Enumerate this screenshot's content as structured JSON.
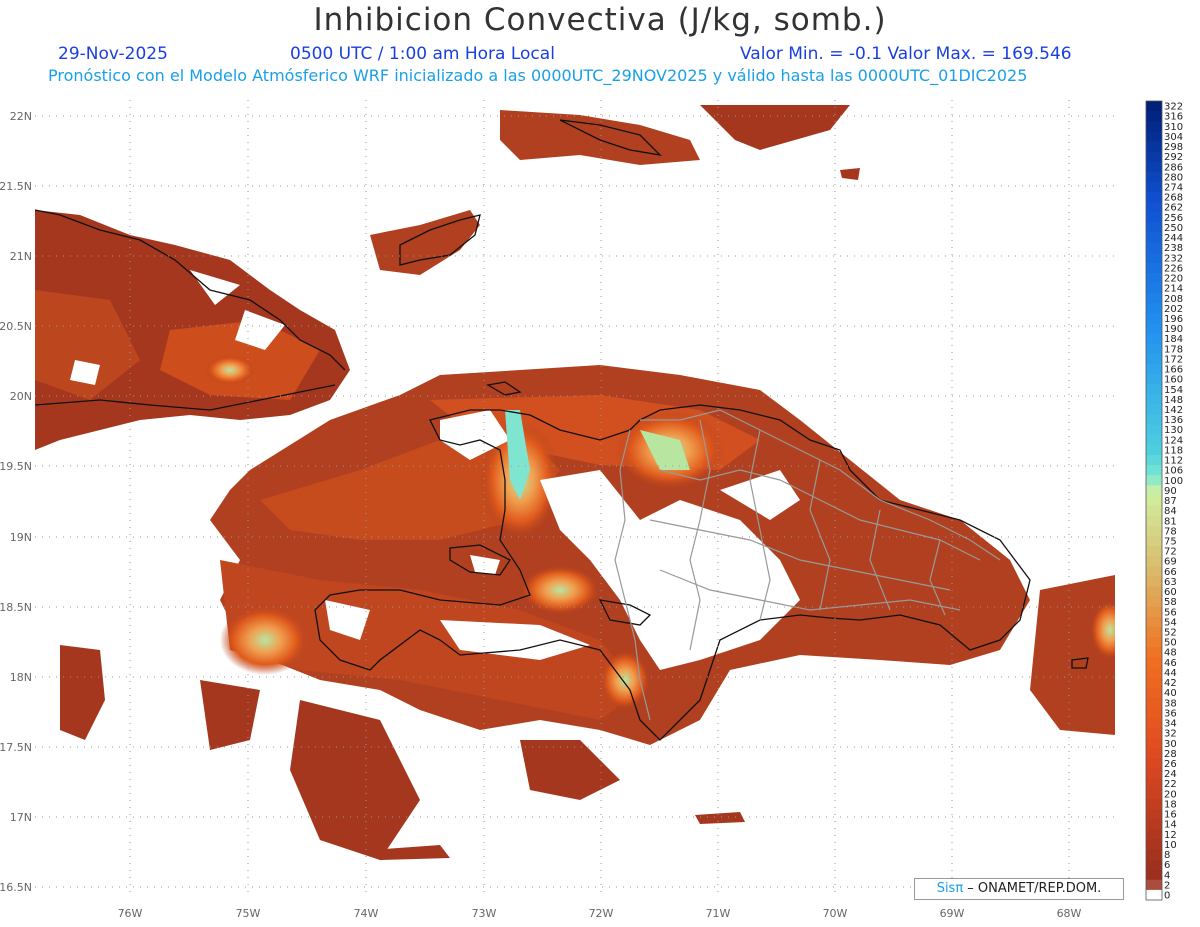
{
  "header": {
    "title": "Inhibicion Convectiva (J/kg, somb.)",
    "date": "29-Nov-2025",
    "time": "0500 UTC / 1:00 am Hora Local",
    "range": "Valor Min. = -0.1  Valor Max. = 169.546",
    "subtitle": "Pronóstico con el Modelo Atmósferico WRF inicializado a las 0000UTC_29NOV2025 y válido hasta las  0000UTC_01DIC2025"
  },
  "axes": {
    "lat_labels": [
      "22N",
      "21.5N",
      "21N",
      "20.5N",
      "20N",
      "19.5N",
      "19N",
      "18.5N",
      "18N",
      "17.5N",
      "17N",
      "16.5N"
    ],
    "lon_labels": [
      "76W",
      "75W",
      "74W",
      "73W",
      "72W",
      "71W",
      "70W",
      "69W",
      "68W"
    ]
  },
  "colorbar": {
    "labels": [
      "322",
      "316",
      "310",
      "304",
      "298",
      "292",
      "286",
      "280",
      "274",
      "268",
      "262",
      "256",
      "250",
      "244",
      "238",
      "232",
      "226",
      "220",
      "214",
      "208",
      "202",
      "196",
      "190",
      "184",
      "178",
      "172",
      "166",
      "160",
      "154",
      "148",
      "142",
      "136",
      "130",
      "124",
      "118",
      "112",
      "106",
      "100",
      "90",
      "87",
      "84",
      "81",
      "78",
      "75",
      "72",
      "69",
      "66",
      "63",
      "60",
      "58",
      "56",
      "54",
      "52",
      "50",
      "48",
      "46",
      "44",
      "42",
      "40",
      "38",
      "36",
      "34",
      "32",
      "30",
      "28",
      "26",
      "24",
      "22",
      "20",
      "18",
      "16",
      "14",
      "12",
      "10",
      "8",
      "6",
      "4",
      "2",
      "0"
    ]
  },
  "credit": {
    "brand": "Sisπ",
    "text": " – ONAMET/REP.DOM."
  },
  "colors": {
    "low": "#9c2f1e",
    "mid": "#e05a1c",
    "high_green": "#b8e6a0",
    "cyan": "#7fe5d0",
    "blue_top": "#00207a"
  }
}
